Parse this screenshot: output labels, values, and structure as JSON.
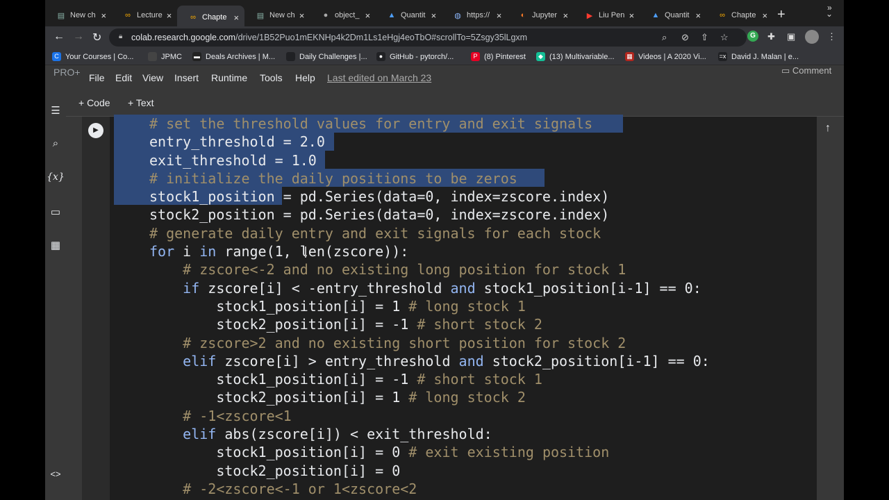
{
  "browser": {
    "tabs": [
      {
        "label": "New ch",
        "icon": "colab-doc-icon",
        "active": false
      },
      {
        "label": "Lecture",
        "icon": "colab-icon",
        "active": false
      },
      {
        "label": "Chapte",
        "icon": "colab-icon",
        "active": true
      },
      {
        "label": "New ch",
        "icon": "colab-doc-icon",
        "active": false
      },
      {
        "label": "object_",
        "icon": "github-icon",
        "active": false
      },
      {
        "label": "Quantit",
        "icon": "drive-icon",
        "active": false
      },
      {
        "label": "https://",
        "icon": "globe-icon",
        "active": false
      },
      {
        "label": "Jupyter",
        "icon": "jupyter-icon",
        "active": false
      },
      {
        "label": "Liu Pen",
        "icon": "youtube-icon",
        "active": false
      },
      {
        "label": "Quantit",
        "icon": "drive-icon",
        "active": false
      },
      {
        "label": "Chapte",
        "icon": "colab-icon",
        "active": false
      }
    ],
    "url_domain": "colab.research.google.com",
    "url_path": "/drive/1B52Puo1mEKNHp4k2Dm1Ls1eHgj4eoTbO#scrollTo=5Zsgy35lLgxm",
    "bookmarks": [
      {
        "label": "Your Courses | Co...",
        "color": "#1a73e8",
        "glyph": "C"
      },
      {
        "label": "JPMC",
        "color": "#444444",
        "glyph": ""
      },
      {
        "label": "Deals Archives | M...",
        "color": "#222222",
        "glyph": "▬"
      },
      {
        "label": "Daily Challenges |...",
        "color": "#202124",
        "glyph": ""
      },
      {
        "label": "GitHub - pytorch/...",
        "color": "#202124",
        "glyph": "●"
      },
      {
        "label": "(8) Pinterest",
        "color": "#e60023",
        "glyph": "P"
      },
      {
        "label": "(13) Multivariable...",
        "color": "#14bf96",
        "glyph": "◆"
      },
      {
        "label": "Videos | A 2020 Vi...",
        "color": "#b3261e",
        "glyph": "▦"
      },
      {
        "label": "David J. Malan | e...",
        "color": "#202124",
        "glyph": "=x"
      }
    ]
  },
  "colab": {
    "pro_label": "PRO+",
    "menu": [
      "File",
      "Edit",
      "View",
      "Insert",
      "Runtime",
      "Tools",
      "Help"
    ],
    "last_edited": "Last edited on March 23",
    "comment_label": "Comment",
    "add_code": "+ Code",
    "add_text": "+ Text"
  },
  "code_lines": [
    [
      {
        "t": "# set the threshold values for entry and exit signals",
        "c": "com"
      }
    ],
    [
      {
        "t": "entry_threshold = 2.0",
        "c": ""
      }
    ],
    [
      {
        "t": "exit_threshold = 1.0",
        "c": ""
      }
    ],
    [
      {
        "t": "# initialize the daily positions to be zeros",
        "c": "com"
      }
    ],
    [
      {
        "t": "stock1_position = pd.Series(data=0, index=zscore.index)",
        "c": ""
      }
    ],
    [
      {
        "t": "stock2_position = pd.Series(data=0, index=zscore.index)",
        "c": ""
      }
    ],
    [
      {
        "t": "# generate daily entry and exit signals for each stock",
        "c": "com"
      }
    ],
    [
      {
        "t": "for",
        "c": "kw"
      },
      {
        "t": " i ",
        "c": ""
      },
      {
        "t": "in",
        "c": "kw"
      },
      {
        "t": " range(1, len(zscore)):",
        "c": ""
      }
    ],
    [
      {
        "t": "    ",
        "c": ""
      },
      {
        "t": "# zscore<-2 and no existing long position for stock 1",
        "c": "com"
      }
    ],
    [
      {
        "t": "    ",
        "c": ""
      },
      {
        "t": "if",
        "c": "kw"
      },
      {
        "t": " zscore[i] < -entry_threshold ",
        "c": ""
      },
      {
        "t": "and",
        "c": "kw"
      },
      {
        "t": " stock1_position[i-1] == 0:",
        "c": ""
      }
    ],
    [
      {
        "t": "        stock1_position[i] = 1 ",
        "c": ""
      },
      {
        "t": "# long stock 1",
        "c": "com"
      }
    ],
    [
      {
        "t": "        stock2_position[i] = -1 ",
        "c": ""
      },
      {
        "t": "# short stock 2",
        "c": "com"
      }
    ],
    [
      {
        "t": "    ",
        "c": ""
      },
      {
        "t": "# zscore>2 and no existing short position for stock 2",
        "c": "com"
      }
    ],
    [
      {
        "t": "    ",
        "c": ""
      },
      {
        "t": "elif",
        "c": "kw"
      },
      {
        "t": " zscore[i] > entry_threshold ",
        "c": ""
      },
      {
        "t": "and",
        "c": "kw"
      },
      {
        "t": " stock2_position[i-1] == 0:",
        "c": ""
      }
    ],
    [
      {
        "t": "        stock1_position[i] = -1 ",
        "c": ""
      },
      {
        "t": "# short stock 1",
        "c": "com"
      }
    ],
    [
      {
        "t": "        stock2_position[i] = 1 ",
        "c": ""
      },
      {
        "t": "# long stock 2",
        "c": "com"
      }
    ],
    [
      {
        "t": "    ",
        "c": ""
      },
      {
        "t": "# -1<zscore<1",
        "c": "com"
      }
    ],
    [
      {
        "t": "    ",
        "c": ""
      },
      {
        "t": "elif",
        "c": "kw"
      },
      {
        "t": " abs(zscore[i]) < exit_threshold:",
        "c": ""
      }
    ],
    [
      {
        "t": "        stock1_position[i] = 0 ",
        "c": ""
      },
      {
        "t": "# exit existing position",
        "c": "com"
      }
    ],
    [
      {
        "t": "        stock2_position[i] = 0",
        "c": ""
      }
    ],
    [
      {
        "t": "    ",
        "c": ""
      },
      {
        "t": "# -2<zscore<-1 or 1<zscore<2",
        "c": "com"
      }
    ]
  ],
  "colors": {
    "selection": "#2f4a7a",
    "keyword": "#93b6f2",
    "comment": "#a08f6a",
    "code_bg": "#1e1e1e"
  }
}
